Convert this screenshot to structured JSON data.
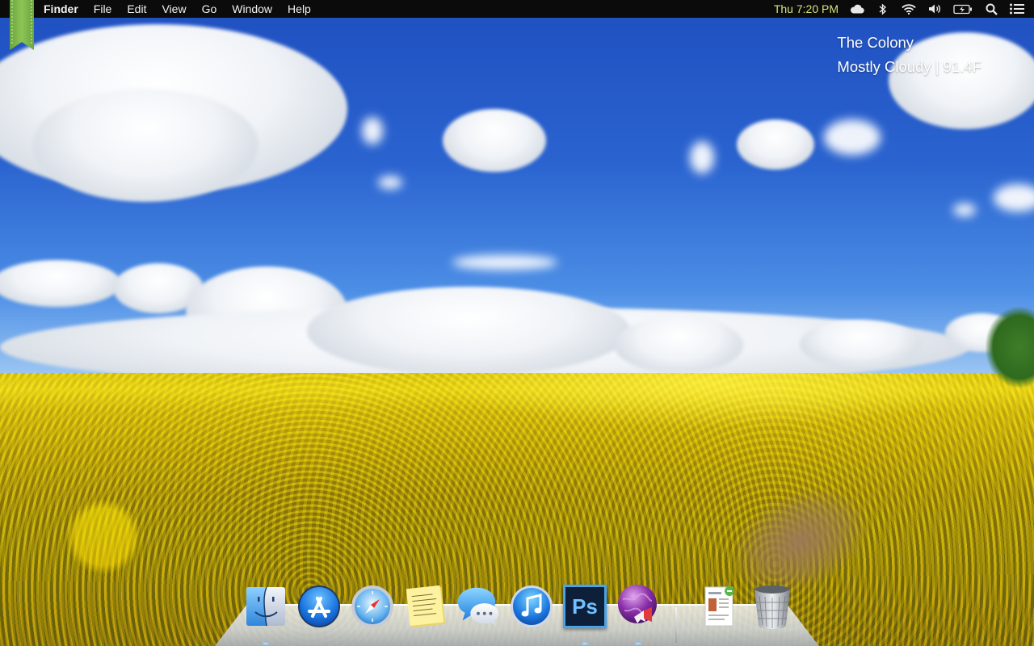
{
  "menubar": {
    "apple_icon": "apple-logo-icon",
    "items": [
      {
        "label": "Finder",
        "bold": true
      },
      {
        "label": "File"
      },
      {
        "label": "Edit"
      },
      {
        "label": "View"
      },
      {
        "label": "Go"
      },
      {
        "label": "Window"
      },
      {
        "label": "Help"
      }
    ],
    "clock": "Thu 7:20 PM",
    "status_icons": [
      "cloud-icon",
      "bluetooth-icon",
      "wifi-icon",
      "volume-icon",
      "battery-icon",
      "spotlight-search-icon",
      "notification-center-icon"
    ]
  },
  "weather": {
    "location": "The Colony",
    "condition": "Mostly Cloudy | 91.4F"
  },
  "dock": {
    "apps": [
      "finder-icon",
      "app-store-icon",
      "safari-icon",
      "stickies-icon",
      "messages-icon",
      "itunes-icon",
      "photoshop-icon",
      "web-browser-globe-icon"
    ],
    "stacks": [
      "document-stack-icon",
      "trash-icon"
    ],
    "photoshop_label": "Ps"
  },
  "colors": {
    "menubar_bg": "#0b0b0b",
    "clock": "#d8e27a",
    "ribbon": "#7db54a"
  }
}
